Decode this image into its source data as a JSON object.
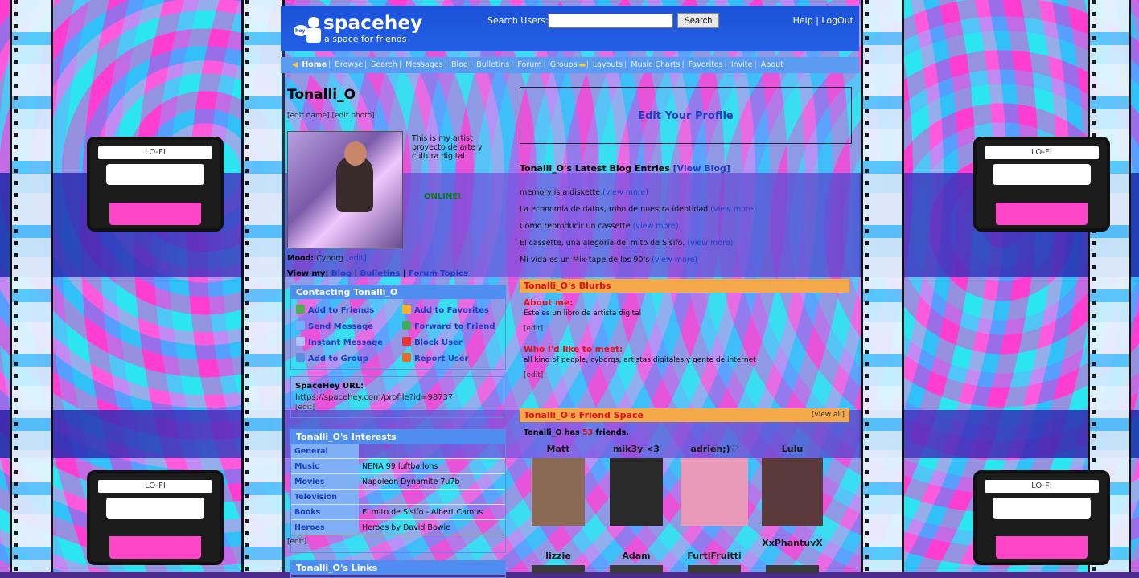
{
  "header": {
    "brand": "spacehey",
    "tagline": "a space for friends",
    "search_label": "Search Users:",
    "search_value": "",
    "search_button": "Search",
    "help": "Help",
    "sep": "|",
    "logout": "LogOut"
  },
  "nav": {
    "items": [
      "Home",
      "Browse",
      "Search",
      "Messages",
      "Blog",
      "Bulletins",
      "Forum",
      "Groups",
      "Layouts",
      "Music Charts",
      "Favorites",
      "Invite",
      "About"
    ]
  },
  "profile": {
    "name": "Tonalli_O",
    "edit_name": "[edit name]",
    "edit_photo": "[edit photo]",
    "bio": "This is my artist proyecto de arte y cultura digital",
    "status": "ONLINE!",
    "mood_label": "Mood:",
    "mood_value": "Cyborg",
    "mood_edit": "[edit]",
    "viewmy_label": "View my:",
    "viewmy_blog": "Blog",
    "viewmy_bulletins": "Bulletins",
    "viewmy_forum": "Forum Topics",
    "bar": "|"
  },
  "contact": {
    "title": "Contacting Tonalli_O",
    "add_friends": "Add to Friends",
    "add_favorites": "Add to Favorites",
    "send_message": "Send Message",
    "forward": "Forward to Friend",
    "instant_message": "Instant Message",
    "block": "Block User",
    "add_group": "Add to Group",
    "report": "Report User"
  },
  "url_box": {
    "title": "SpaceHey URL:",
    "url": "https://spacehey.com/profile?id=98737",
    "edit": "[edit]"
  },
  "interests": {
    "title": "Tonalli_O's Interests",
    "rows": [
      {
        "k": "General",
        "v": ""
      },
      {
        "k": "Music",
        "v": "NENA 99 luftballons"
      },
      {
        "k": "Movies",
        "v": "Napoleon Dynamite 7u7b"
      },
      {
        "k": "Television",
        "v": ""
      },
      {
        "k": "Books",
        "v": "El mito de Sísifo - Albert Camus"
      },
      {
        "k": "Heroes",
        "v": "Heroes by David Bowie"
      }
    ],
    "edit": "[edit]"
  },
  "links": {
    "title": "Tonalli_O's Links"
  },
  "edit_profile": "Edit Your Profile",
  "blog": {
    "title": "Tonalli_O's Latest Blog Entries",
    "view_blog": "[View Blog]",
    "view_more": "(view more)",
    "entries": [
      "memory is a diskette",
      "La economía de datos, robo de nuestra identidad",
      "Como reproducir un cassette",
      "El cassette, una alegoría del mito de Sísifo.",
      "Mi vida es un Mix-tape de los 90's"
    ]
  },
  "blurbs": {
    "title": "Tonalli_O's Blurbs",
    "about_label": "About me:",
    "about_value": "Este es un libro de artista digital",
    "meet_label": "Who I'd like to meet:",
    "meet_value": "all kind of people, cyborgs, artistas digitales y gente de internet",
    "edit": "[edit]"
  },
  "friends": {
    "title": "Tonalli_O's Friend Space",
    "view_all": "[view all]",
    "count_prefix": "Tonalli_O has",
    "count": "53",
    "count_suffix": "friends.",
    "list": [
      {
        "name": "Matt",
        "color": "#8a6a55"
      },
      {
        "name": "mik3y <3",
        "color": "#2a2a2a"
      },
      {
        "name": "adrien;)♡",
        "color": "#e89ab8"
      },
      {
        "name": "Lulu",
        "color": "#5a3a3a"
      },
      {
        "name": "lizzie",
        "color": "#3a3a3a"
      },
      {
        "name": "Adam",
        "color": "#3a3a3a"
      },
      {
        "name": "FurtiFruitti",
        "color": "#3a3a3a"
      },
      {
        "name": "XxPhantuvX",
        "color": "#3a3a3a"
      }
    ]
  },
  "background": {
    "label": "LO-FI"
  }
}
